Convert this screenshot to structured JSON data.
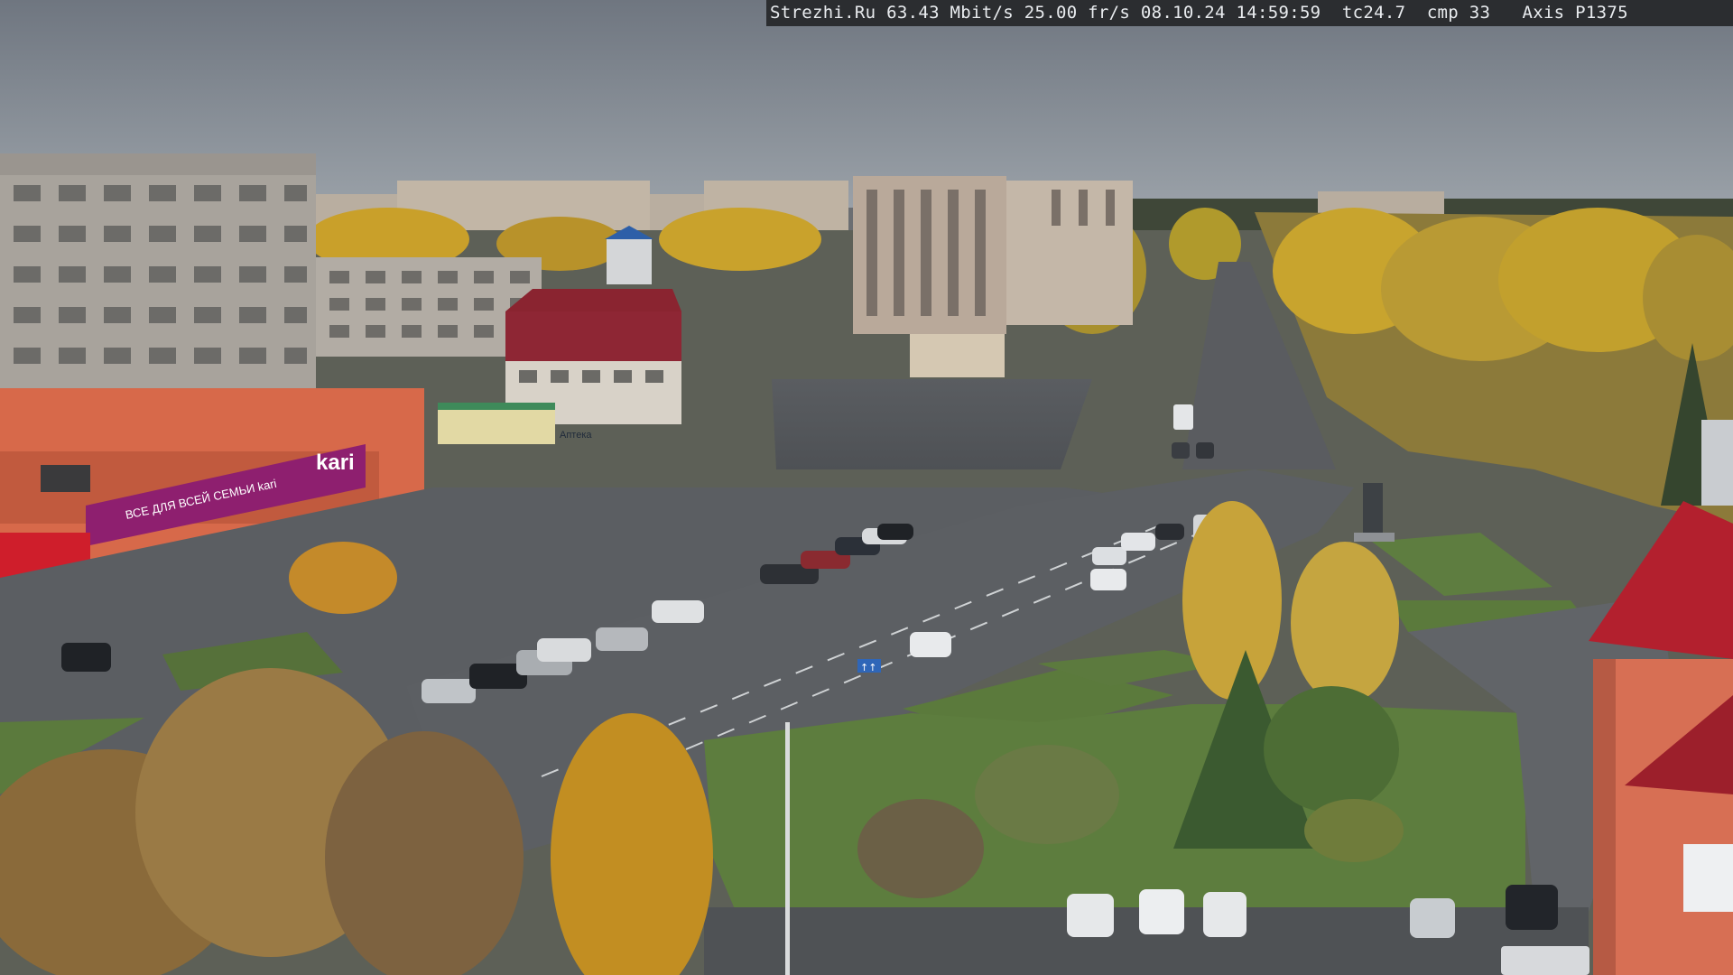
{
  "overlay": {
    "text": "Strezhi.Ru 63.43 Mbit/s 25.00 fr/s 08.10.24 14:59:59  tc24.7  cmp 33   Axis P1375"
  },
  "signs": {
    "store_name": "kari",
    "store_banner": "ВСЕ ДЛЯ ВСЕЙ СЕМЬИ kari",
    "pharmacy": "Аптека",
    "lane_sign": "↑↑"
  },
  "colors": {
    "sky": "#7f8790",
    "road": "#55585c",
    "grass": "#5c7a3e",
    "autumn": "#c9a02a",
    "kari_magenta": "#8e1f6f",
    "red_roof": "#b3202e"
  }
}
